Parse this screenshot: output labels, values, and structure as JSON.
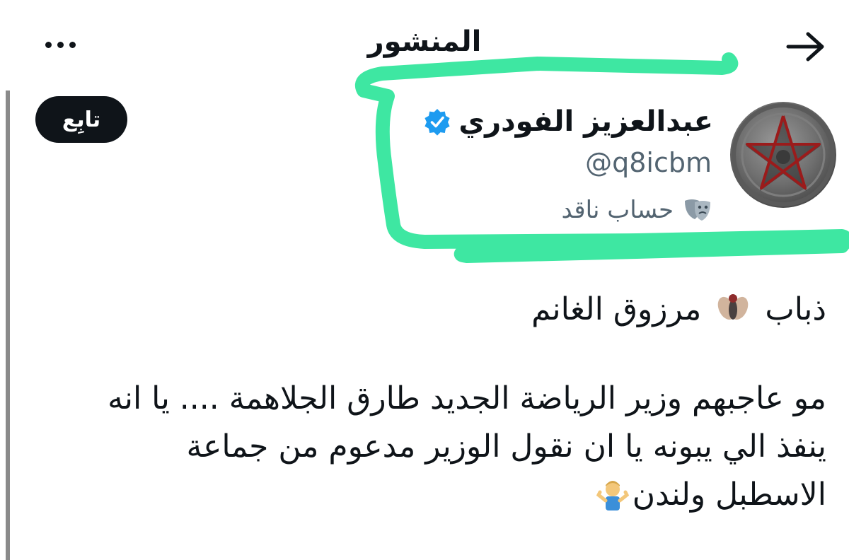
{
  "header": {
    "title": "المنشور",
    "back_icon": "arrow-right-icon",
    "more_icon": "more-dots-icon"
  },
  "author": {
    "display_name": "عبدالعزيز الفودري",
    "handle": "@q8icbm",
    "verified": true,
    "verified_color": "#1d9bf0",
    "label_icon": "performing-arts-mask-icon",
    "label": "حساب ناقد",
    "avatar_description_icon": "pentagram-avatar"
  },
  "follow_button": {
    "label": "تابِع"
  },
  "post": {
    "line1_prefix": "ذباب",
    "line1_emoji": "fly-emoji",
    "line1_suffix": "مرزوق الغانم",
    "paragraph_lines": [
      "مو عاجبهم وزير الرياضة الجديد طارق الجلاهمة .... يا انه",
      "ينفذ الي يبونه يا ان نقول الوزير مدعوم من جماعة",
      "الاسطبل ولندن"
    ],
    "end_emoji": "man-shrugging-emoji"
  },
  "colors": {
    "highlight": "#3ee7a2",
    "text": "#0f1419",
    "secondary_text": "#536471",
    "follow_bg": "#0f1419"
  }
}
